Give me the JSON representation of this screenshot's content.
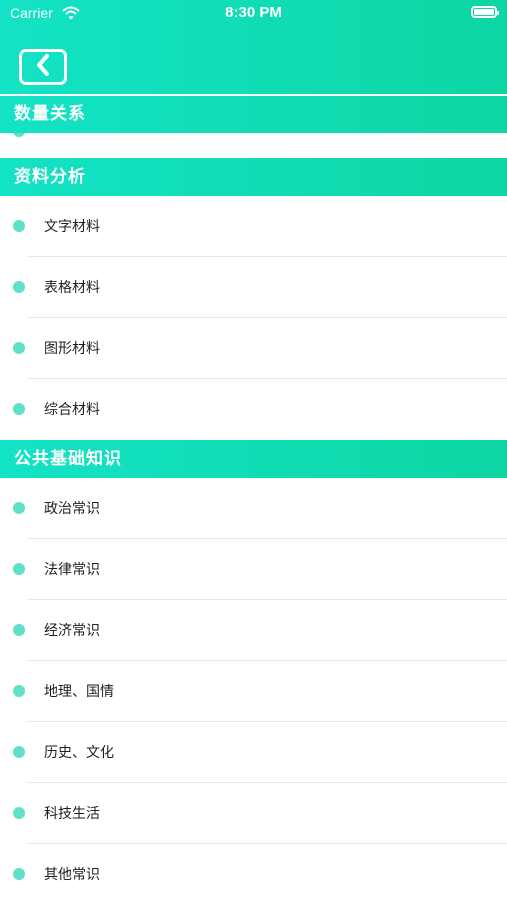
{
  "status_bar": {
    "carrier": "Carrier",
    "time": "8:30 PM"
  },
  "nav": {
    "back_icon": "chevron-left-icon"
  },
  "colors": {
    "accent_start": "#13e3c6",
    "accent_end": "#0ed6a3",
    "bullet": "#5fe0c8"
  },
  "sections": [
    {
      "title": "数量关系",
      "items": []
    },
    {
      "title": "资料分析",
      "items": [
        "文字材料",
        "表格材料",
        "图形材料",
        "综合材料"
      ]
    },
    {
      "title": "公共基础知识",
      "items": [
        "政治常识",
        "法律常识",
        "经济常识",
        "地理、国情",
        "历史、文化",
        "科技生活",
        "其他常识"
      ]
    }
  ]
}
